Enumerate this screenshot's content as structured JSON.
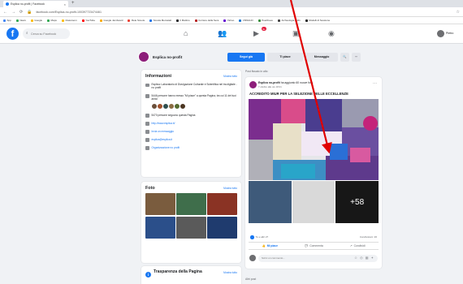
{
  "browser": {
    "tab_title": "Esplica no-profit | Facebook",
    "tab_close": "×",
    "tab_new": "+",
    "url": "facebook.com/Esplica-no-profit-100397723474461",
    "bookmarks": [
      {
        "label": "App",
        "color": "#4285f4"
      },
      {
        "label": "News",
        "color": "#34a853"
      },
      {
        "label": "Google",
        "color": "#fbbc05"
      },
      {
        "label": "Maps",
        "color": "#34a853"
      },
      {
        "label": "Classroom",
        "color": "#fbbc05"
      },
      {
        "label": "YouTube",
        "color": "#ff0000"
      },
      {
        "label": "Google Jamboard",
        "color": "#f9ab00"
      },
      {
        "label": "Rete Scuole",
        "color": "#ea4335"
      },
      {
        "label": "Scuola Mercatali",
        "color": "#1a73e8"
      },
      {
        "label": "Il Mattino",
        "color": "#202124"
      },
      {
        "label": "Corriere della Sera",
        "color": "#b71c1c"
      },
      {
        "label": "Yahoo",
        "color": "#6001d2"
      },
      {
        "label": "VIRGILIO",
        "color": "#1976d2"
      },
      {
        "label": "Pearltrees",
        "color": "#388e3c"
      },
      {
        "label": "Archeologia 2021",
        "color": "#424242"
      },
      {
        "label": "Modelli di Sessione",
        "color": "#212121"
      }
    ]
  },
  "fb": {
    "logo": "f",
    "search_placeholder": "Cerca su Facebook",
    "notif_count": "9+",
    "user_name": "Pietro"
  },
  "page": {
    "name": "Esplica no-profit",
    "btn_follow": "Segui già",
    "btn_like": "Ti piace",
    "btn_message": "Messaggio",
    "btn_search": "🔍",
    "btn_more": "···"
  },
  "info": {
    "title": "Informazioni",
    "see_all": "Mostra tutto",
    "rows": [
      {
        "text": "Esplica: Laboratorio di Divulgazione Culturale e Scientifica nel tra digitale - no profit",
        "link": false
      },
      {
        "text": "5446 persone hanno messo \"Mi piace\" a questa Pagina, tra cui 11 dei tuoi amici",
        "link": false
      },
      {
        "text": "5470 persone seguono questa Pagina",
        "link": false
      },
      {
        "text": "http://www.esplica.it/",
        "link": true
      },
      {
        "text": "Invia un messaggio",
        "link": true
      },
      {
        "text": "esplica@esplica.it",
        "link": true
      },
      {
        "text": "Organizzazione no profit",
        "link": true
      }
    ],
    "face_colors": [
      "#6b4f3a",
      "#a0522d",
      "#2f4f4f",
      "#8b6c42",
      "#556b2f",
      "#4b3621"
    ]
  },
  "foto": {
    "title": "Foto",
    "see_all": "Mostra tutto",
    "colors": [
      "#7a5c3e",
      "#3f6e4b",
      "#8a3324",
      "#2b4f8a",
      "#5a5a5a",
      "#1f3b6e"
    ]
  },
  "trasparenza": {
    "title": "Trasparenza della Pagina",
    "see_all": "Mostra tutto",
    "icon": "i"
  },
  "feed": {
    "label": "Post fissato in alto",
    "post": {
      "author": "Esplica no-profit",
      "author_suffix": " ha aggiunto 60 nuove foto.",
      "meta": "7 ottobre alle ore 18:21",
      "more": "···",
      "text": "ACCREDITO MIUR PER LA SELEZIONE DELLE ECCELLENZE",
      "thumb_colors": [
        "#3e5a7a",
        "#d9d9d9",
        "#2a2a2a"
      ],
      "plus_label": "+58",
      "reactions": "Tu e altri 27",
      "shares": "Condivisioni: 26",
      "action_like": "Mi piace",
      "action_comment": "Commenta",
      "action_share": "Condividi",
      "comment_placeholder": "Scrivi un commento...",
      "comment_icons": "☺ ◎ ▦ ✦"
    },
    "more_posts": "Altri post"
  },
  "annotation": {
    "arrow_color": "#e00000"
  }
}
